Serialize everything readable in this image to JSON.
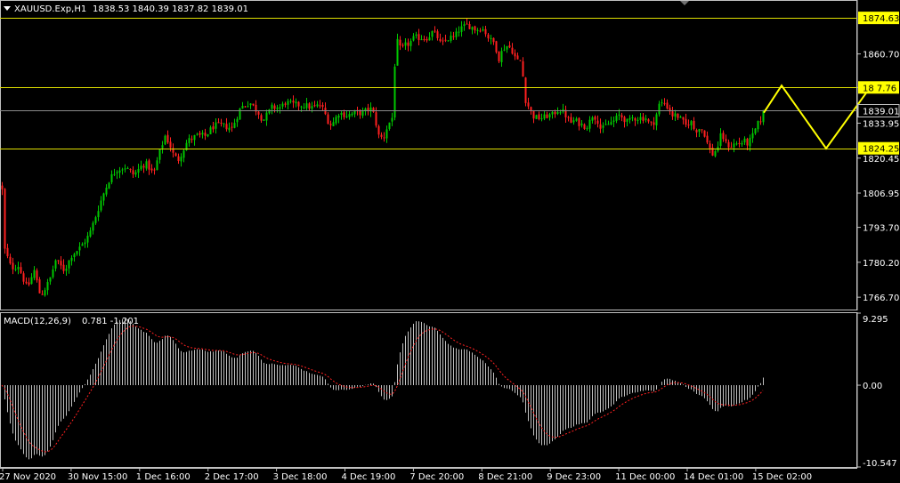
{
  "colors": {
    "background": "#000000",
    "axis": "#c0c0c0",
    "text": "#ffffff",
    "bull": "#00c800",
    "bear": "#ff2020",
    "level_line": "#e0e000",
    "level_label_bg": "#ffff00",
    "price_line": "#8a8a8a",
    "macd_hist": "#c0c0c0",
    "macd_signal": "#ff2020",
    "projection": "#ffff00"
  },
  "header": {
    "menu_icon": "triangle-down-icon",
    "symbol": "XAUUSD.Exp,H1",
    "ohlc": "1838.53 1840.39 1837.82 1839.01"
  },
  "chart_data": [
    {
      "type": "candlestick",
      "symbol": "XAUUSD.Exp",
      "timeframe": "H1",
      "x_tick_labels": [
        "27 Nov 2020",
        "30 Nov 15:00",
        "1 Dec 16:00",
        "2 Dec 17:00",
        "3 Dec 18:00",
        "4 Dec 19:00",
        "7 Dec 20:00",
        "8 Dec 21:00",
        "9 Dec 23:00",
        "11 Dec 00:00",
        "14 Dec 01:00",
        "15 Dec 02:00"
      ],
      "y_tick_labels": [
        "1860.70",
        "1847.76",
        "1833.95",
        "1820.45",
        "1806.95",
        "1793.70",
        "1780.20",
        "1766.70"
      ],
      "ylim": [
        1761.6,
        1881.2
      ],
      "levels": [
        {
          "price": 1874.63,
          "label": "1874.63"
        },
        {
          "price": 1847.76,
          "label": "18 7.76"
        },
        {
          "price": 1824.25,
          "label": "1824.25"
        }
      ],
      "current_price": {
        "price": 1839.01,
        "label": "1839.01"
      },
      "last_bar": {
        "open": 1838.53,
        "high": 1840.39,
        "low": 1837.82,
        "close": 1839.01
      },
      "close_path_anchors": [
        [
          0,
          1810
        ],
        [
          2,
          1808
        ],
        [
          5,
          1785
        ],
        [
          12,
          1778
        ],
        [
          20,
          1779
        ],
        [
          30,
          1770
        ],
        [
          38,
          1777
        ],
        [
          45,
          1767
        ],
        [
          55,
          1773
        ],
        [
          62,
          1781
        ],
        [
          72,
          1777
        ],
        [
          80,
          1783
        ],
        [
          90,
          1786
        ],
        [
          100,
          1791
        ],
        [
          108,
          1799
        ],
        [
          115,
          1806
        ],
        [
          122,
          1812
        ],
        [
          130,
          1816
        ],
        [
          140,
          1817
        ],
        [
          150,
          1814
        ],
        [
          160,
          1818
        ],
        [
          165,
          1818
        ],
        [
          172,
          1814
        ],
        [
          178,
          1822
        ],
        [
          185,
          1829
        ],
        [
          190,
          1826
        ],
        [
          195,
          1821
        ],
        [
          200,
          1820
        ],
        [
          210,
          1827
        ],
        [
          220,
          1829
        ],
        [
          230,
          1829
        ],
        [
          240,
          1833
        ],
        [
          250,
          1833
        ],
        [
          260,
          1832
        ],
        [
          270,
          1840
        ],
        [
          280,
          1842
        ],
        [
          290,
          1838
        ],
        [
          295,
          1835
        ],
        [
          305,
          1840
        ],
        [
          315,
          1840
        ],
        [
          320,
          1842
        ],
        [
          330,
          1841
        ],
        [
          340,
          1841
        ],
        [
          350,
          1840
        ],
        [
          360,
          1841
        ],
        [
          368,
          1835
        ],
        [
          372,
          1833
        ],
        [
          380,
          1838
        ],
        [
          390,
          1837
        ],
        [
          400,
          1838
        ],
        [
          408,
          1838
        ],
        [
          415,
          1840
        ],
        [
          420,
          1837
        ],
        [
          425,
          1829
        ],
        [
          430,
          1828
        ],
        [
          435,
          1833
        ],
        [
          440,
          1836
        ],
        [
          442,
          1852
        ],
        [
          445,
          1866
        ],
        [
          450,
          1862
        ],
        [
          455,
          1864
        ],
        [
          460,
          1865
        ],
        [
          465,
          1867
        ],
        [
          470,
          1867
        ],
        [
          475,
          1867
        ],
        [
          480,
          1867
        ],
        [
          485,
          1869
        ],
        [
          490,
          1868
        ],
        [
          495,
          1864
        ],
        [
          500,
          1866
        ],
        [
          505,
          1867
        ],
        [
          510,
          1867
        ],
        [
          515,
          1870
        ],
        [
          520,
          1871
        ],
        [
          525,
          1872
        ],
        [
          530,
          1871
        ],
        [
          535,
          1870
        ],
        [
          540,
          1871
        ],
        [
          545,
          1869
        ],
        [
          550,
          1866
        ],
        [
          555,
          1865
        ],
        [
          560,
          1859
        ],
        [
          565,
          1863
        ],
        [
          570,
          1864
        ],
        [
          575,
          1862
        ],
        [
          580,
          1858
        ],
        [
          585,
          1858
        ],
        [
          590,
          1843
        ],
        [
          595,
          1839
        ],
        [
          600,
          1836
        ],
        [
          605,
          1836
        ],
        [
          610,
          1836
        ],
        [
          615,
          1837
        ],
        [
          620,
          1837
        ],
        [
          625,
          1839
        ],
        [
          630,
          1839
        ],
        [
          635,
          1837
        ],
        [
          640,
          1834
        ],
        [
          645,
          1835
        ],
        [
          650,
          1834
        ],
        [
          655,
          1833
        ],
        [
          660,
          1833
        ],
        [
          665,
          1837
        ],
        [
          670,
          1836
        ],
        [
          675,
          1831
        ],
        [
          680,
          1833
        ],
        [
          685,
          1834
        ],
        [
          690,
          1835
        ],
        [
          695,
          1837
        ],
        [
          700,
          1836
        ],
        [
          705,
          1834
        ],
        [
          710,
          1836
        ],
        [
          715,
          1836
        ],
        [
          720,
          1836
        ],
        [
          725,
          1836
        ],
        [
          730,
          1833
        ],
        [
          735,
          1835
        ],
        [
          740,
          1841
        ],
        [
          745,
          1842
        ],
        [
          750,
          1840
        ],
        [
          755,
          1837
        ],
        [
          760,
          1837
        ],
        [
          765,
          1835
        ],
        [
          770,
          1833
        ],
        [
          775,
          1835
        ],
        [
          780,
          1831
        ],
        [
          785,
          1832
        ],
        [
          790,
          1831
        ],
        [
          795,
          1825
        ],
        [
          800,
          1822
        ],
        [
          805,
          1824
        ],
        [
          810,
          1830
        ],
        [
          815,
          1826
        ],
        [
          820,
          1825
        ],
        [
          825,
          1826
        ],
        [
          830,
          1826
        ],
        [
          835,
          1827
        ],
        [
          840,
          1826
        ],
        [
          845,
          1829
        ],
        [
          850,
          1833
        ],
        [
          855,
          1836
        ],
        [
          858,
          1839.01
        ]
      ],
      "projection_path": [
        [
          858,
          1838
        ],
        [
          878,
          1848.5
        ],
        [
          928,
          1824.2
        ],
        [
          978,
          1848
        ]
      ]
    },
    {
      "type": "histogram_line",
      "name": "MACD(12,26,9)",
      "label": "MACD(12,26,9)",
      "values_text": "0.781 -1.201",
      "main": 0.781,
      "signal": -1.201,
      "ylim": [
        -10.547,
        9.295
      ],
      "y_tick_labels": [
        "9.295",
        "0.00",
        "-10.547"
      ]
    }
  ]
}
